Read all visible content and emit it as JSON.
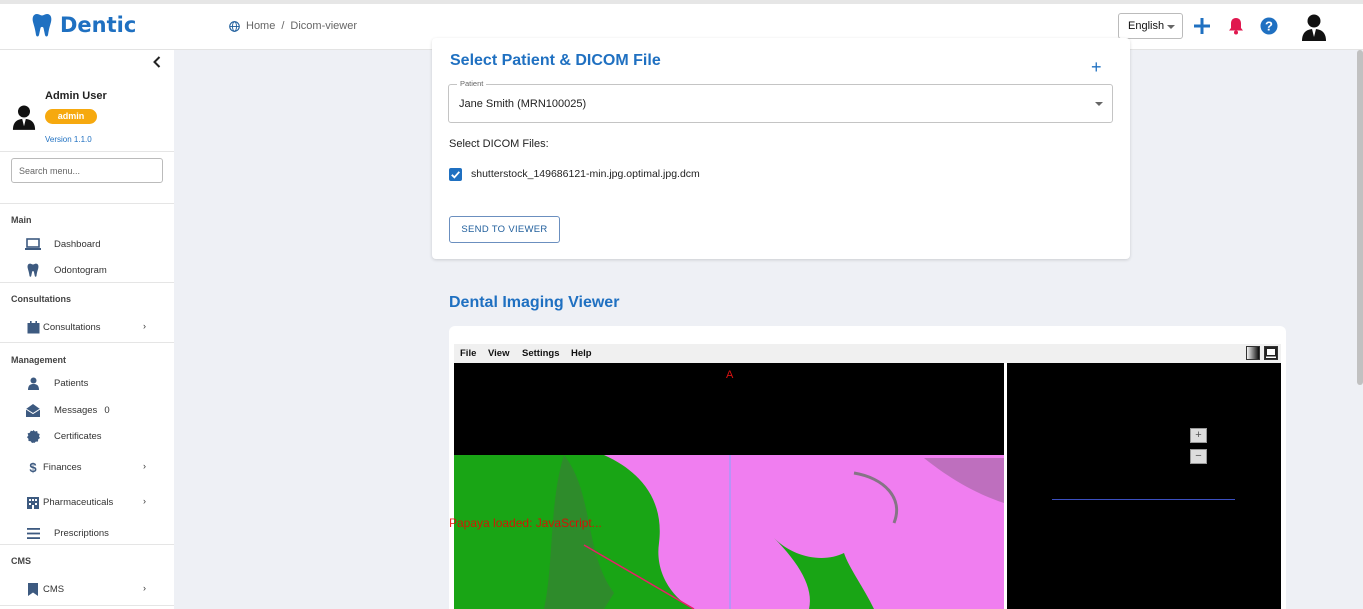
{
  "header": {
    "logo_text": "Dentic",
    "breadcrumb_home": "Home",
    "breadcrumb_sep": "/",
    "breadcrumb_current": "Dicom-viewer",
    "language": "English"
  },
  "sidebar": {
    "user_name": "Admin User",
    "role": "admin",
    "version": "Version 1.1.0",
    "search_placeholder": "Search menu...",
    "sections": {
      "main": "Main",
      "consultations": "Consultations",
      "management": "Management",
      "cms": "CMS"
    },
    "items": {
      "dashboard": "Dashboard",
      "odontogram": "Odontogram",
      "consultations": "Consultations",
      "patients": "Patients",
      "messages": "Messages",
      "messages_count": "0",
      "certificates": "Certificates",
      "finances": "Finances",
      "pharmaceuticals": "Pharmaceuticals",
      "prescriptions": "Prescriptions",
      "cms": "CMS"
    }
  },
  "select_card": {
    "title": "Select Patient & DICOM File",
    "patient_label": "Patient",
    "patient_value": "Jane Smith (MRN100025)",
    "dicom_label": "Select DICOM Files:",
    "file_name": "shutterstock_149686121-min.jpg.optimal.jpg.dcm",
    "file_checked": true,
    "send_button": "SEND TO VIEWER"
  },
  "viewer": {
    "title": "Dental Imaging Viewer",
    "menu": [
      "File",
      "View",
      "Settings",
      "Help"
    ],
    "orientation_label": "A",
    "overlay_text": "Papaya loaded: JavaScript...",
    "zoom_in": "+",
    "zoom_out": "−"
  },
  "colors": {
    "brand": "#1f70c1",
    "badge": "#f6a90f",
    "alert": "#e0184f"
  }
}
